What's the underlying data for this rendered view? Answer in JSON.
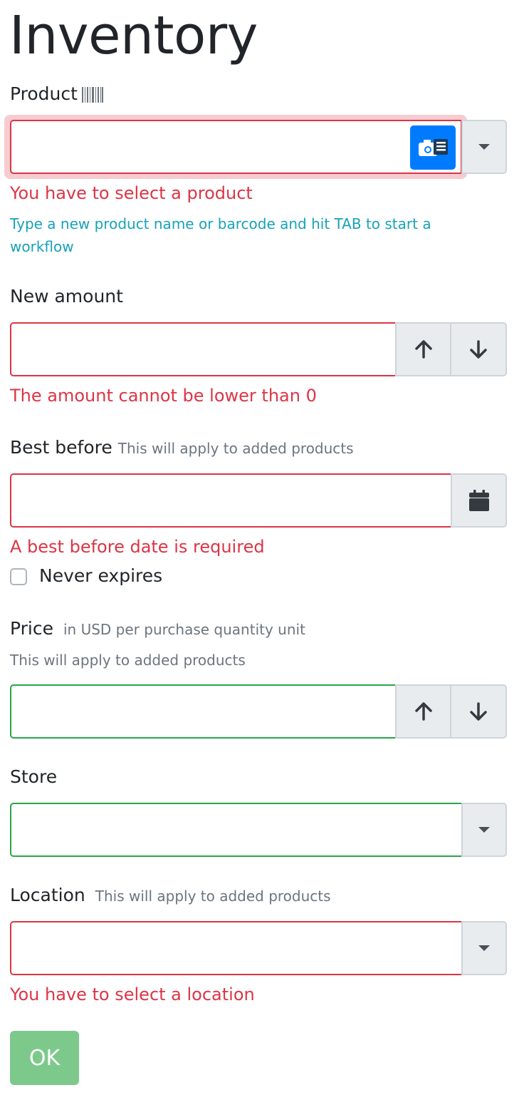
{
  "page": {
    "title": "Inventory"
  },
  "product": {
    "label": "Product",
    "error": "You have to select a product",
    "hint": "Type a new product name or barcode and hit TAB to start a workflow"
  },
  "amount": {
    "label": "New amount",
    "error": "The amount cannot be lower than 0"
  },
  "best_before": {
    "label": "Best before",
    "note": "This will apply to added products",
    "error": "A best before date is required",
    "never_expires_label": "Never expires"
  },
  "price": {
    "label": "Price",
    "unit_note": "in USD per purchase quantity unit",
    "note": "This will apply to added products"
  },
  "store": {
    "label": "Store"
  },
  "location": {
    "label": "Location",
    "note": "This will apply to added products",
    "error": "You have to select a location"
  },
  "submit": {
    "label": "OK"
  },
  "colors": {
    "error": "#dc3545",
    "success": "#28a745",
    "info": "#17a2b8",
    "primary": "#007bff",
    "ok_button": "#7dc98c"
  },
  "icons": [
    "barcode-icon",
    "camera-barcode-icon",
    "caret-down-icon",
    "arrow-up-icon",
    "arrow-down-icon",
    "calendar-icon"
  ]
}
